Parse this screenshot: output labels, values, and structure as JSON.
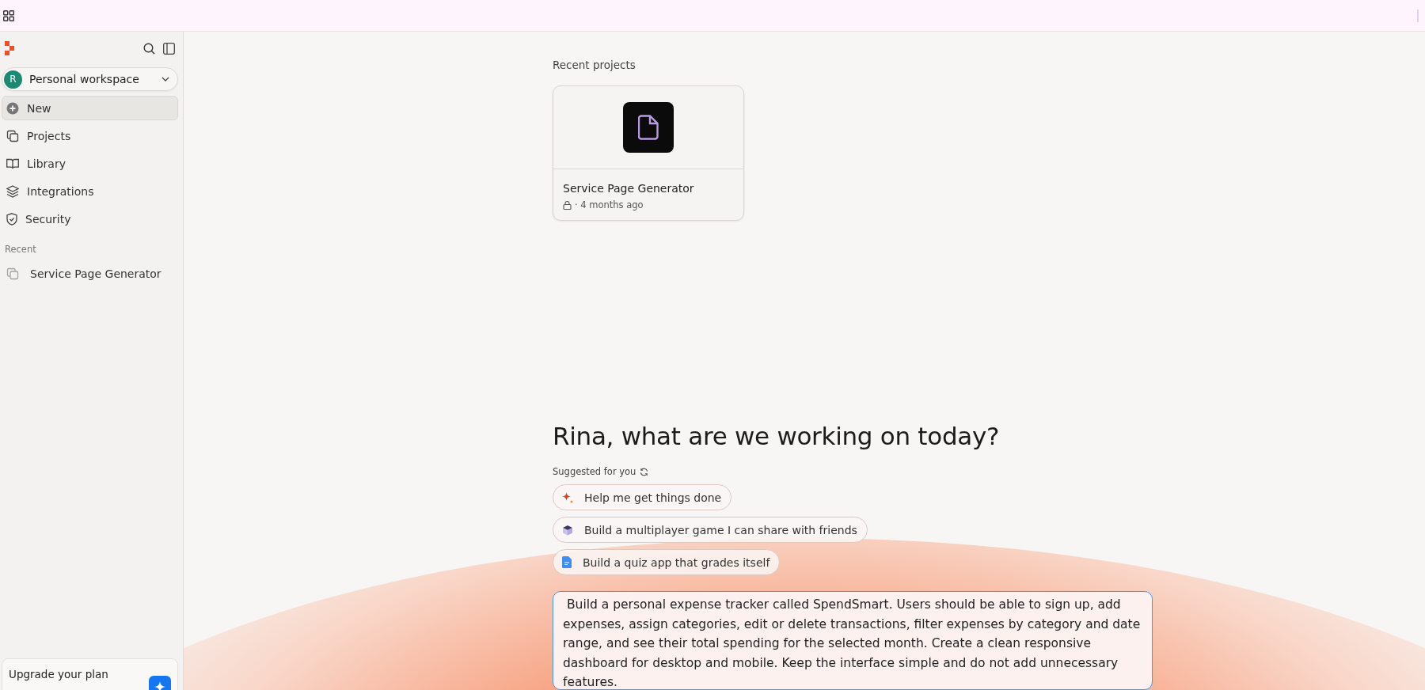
{
  "sidebar": {
    "workspace": {
      "avatar": "R",
      "name": "Personal workspace"
    },
    "nav": [
      {
        "label": "New",
        "selected": true
      },
      {
        "label": "Projects",
        "selected": false
      },
      {
        "label": "Library",
        "selected": false
      },
      {
        "label": "Integrations",
        "selected": false
      },
      {
        "label": "Security",
        "selected": false
      }
    ],
    "recent": {
      "heading": "Recent",
      "items": [
        {
          "label": "Service Page Generator"
        }
      ]
    },
    "upgrade": {
      "label": "Upgrade your plan"
    }
  },
  "main": {
    "recent_projects": {
      "heading": "Recent projects",
      "projects": [
        {
          "title": "Service Page Generator",
          "meta": "· 4 months ago"
        }
      ]
    },
    "greeting": "Rina, what are we working on today?",
    "suggestions": {
      "heading": "Suggested for you",
      "items": [
        {
          "label": "Help me get things done",
          "kind": "sparkle"
        },
        {
          "label": "Build a multiplayer game I can share with friends",
          "kind": "cube"
        },
        {
          "label": "Build a quiz app that grades itself",
          "kind": "document"
        }
      ]
    },
    "prompt": {
      "value": " Build a personal expense tracker called SpendSmart. Users should be able to sign up, add expenses, assign categories, edit or delete transactions, filter expenses by category and date range, and see their total spending for the selected month. Create a clean responsive dashboard for desktop and mobile. Keep the interface simple and do not add unnecessary features.\n"
    }
  }
}
